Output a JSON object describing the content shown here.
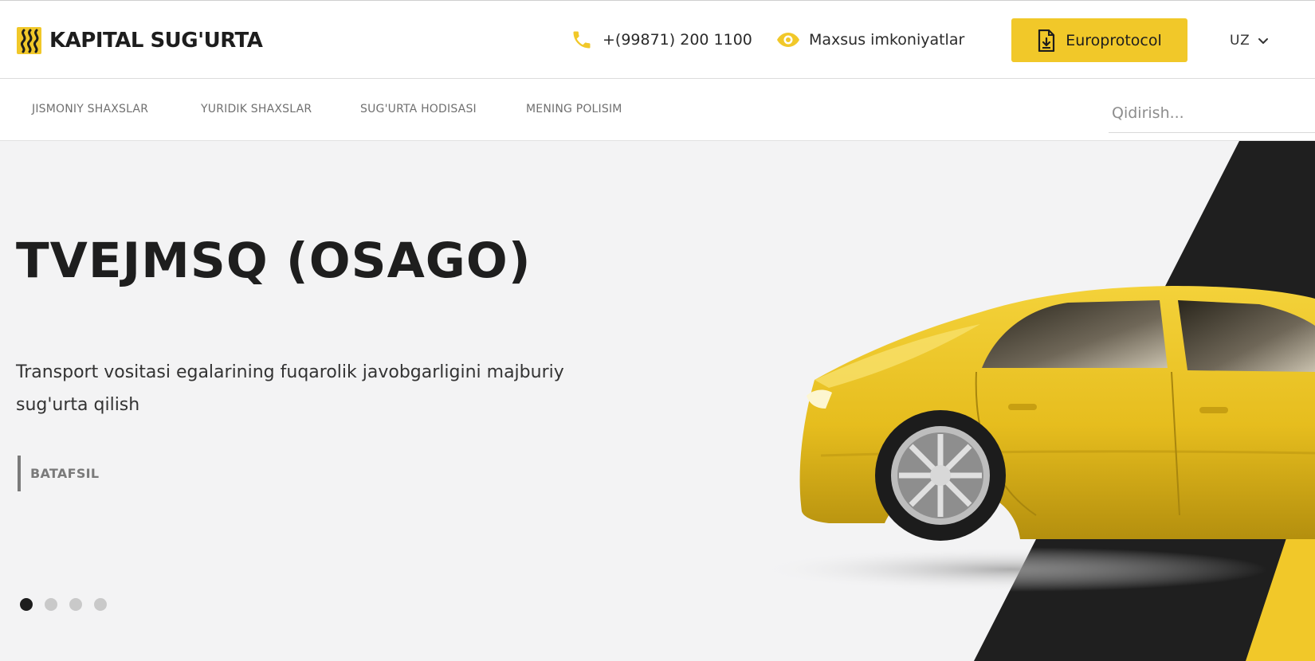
{
  "header": {
    "logo_text": "KAPITAL SUG'URTA",
    "phone": "+(99871) 200 1100",
    "accessibility_label": "Maxsus imkoniyatlar",
    "europrotocol_label": "Europrotocol",
    "language": "UZ",
    "icons": [
      "logo-mark-icon",
      "phone-icon",
      "eye-icon",
      "document-download-icon",
      "chevron-down-icon"
    ]
  },
  "nav": {
    "items": [
      {
        "label": "JISMONIY SHAXSLAR"
      },
      {
        "label": "YURIDIK SHAXSLAR"
      },
      {
        "label": "SUG'URTA HODISASI"
      },
      {
        "label": "MENING POLISIM"
      }
    ],
    "search_placeholder": "Qidirish..."
  },
  "hero": {
    "title": "TVEJMSQ (OSAGO)",
    "description": "Transport vositasi egalarining fuqarolik javobgarligini majburiy sug'urta qilish",
    "more_label": "BATAFSIL",
    "slides_total": 4,
    "active_slide": 1
  },
  "colors": {
    "accent_yellow": "#f1c829",
    "dark": "#1e1e1e",
    "hero_bg": "#f3f3f4",
    "muted_text": "#707070"
  }
}
